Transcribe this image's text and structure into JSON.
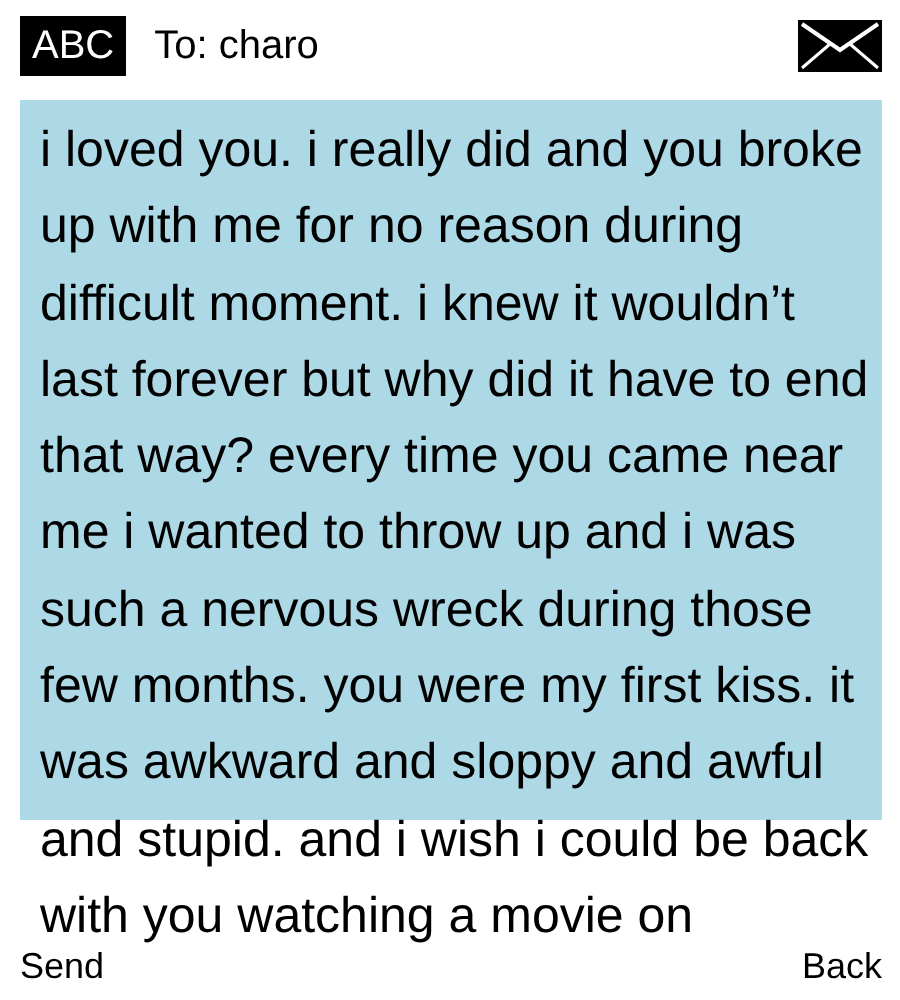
{
  "header": {
    "input_mode": "ABC",
    "recipient": "To: charo"
  },
  "message": {
    "text": "i loved you. i really did and you broke up with me for no reason during  difficult moment. i knew it wouldn’t last forever but why did it have to end that way? every time you came near me i wanted to throw up and i was such a nervous wreck during those few months. you were my first kiss. it was awkward and sloppy and awful and stupid. and i wish i could be back with you watching a movie on"
  },
  "softkeys": {
    "left": "Send",
    "right": "Back"
  }
}
